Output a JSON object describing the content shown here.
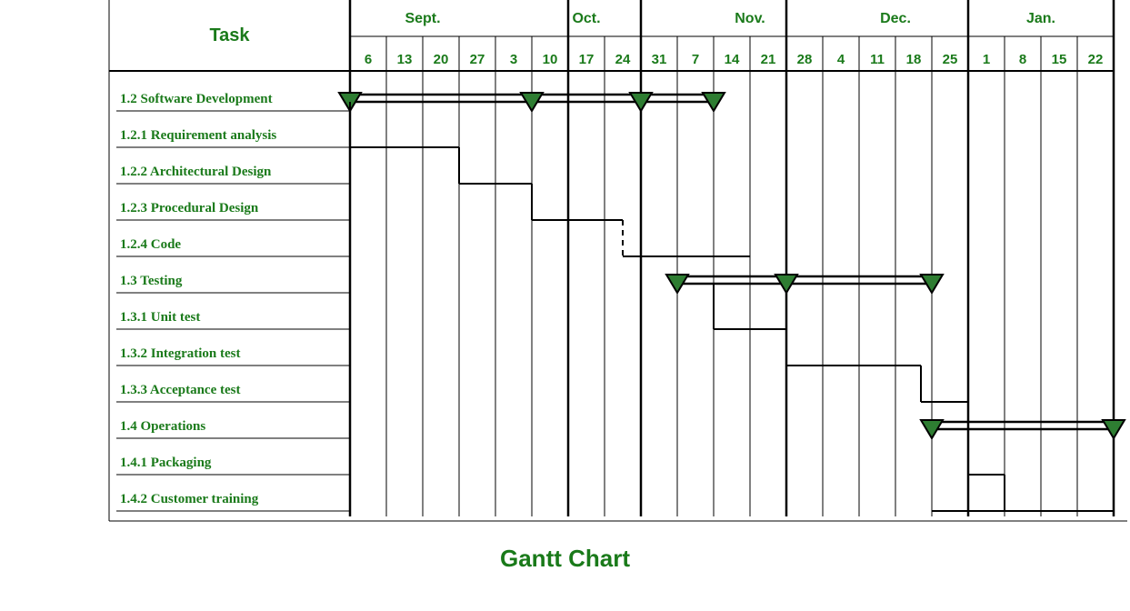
{
  "chart_data": {
    "type": "gantt",
    "title": "Gantt Chart",
    "task_header": "Task",
    "months": [
      "Sept.",
      "Oct.",
      "Nov.",
      "Dec.",
      "Jan."
    ],
    "days": [
      6,
      13,
      20,
      27,
      3,
      10,
      17,
      24,
      31,
      7,
      14,
      21,
      28,
      4,
      11,
      18,
      25,
      1,
      8,
      15,
      22
    ],
    "tasks": [
      {
        "id": "1.2",
        "name": "Software Development",
        "type": "summary",
        "start": 0,
        "end": 10,
        "milestones": [
          0,
          5,
          8,
          10
        ]
      },
      {
        "id": "1.2.1",
        "name": "Requirement analysis",
        "type": "bar",
        "start": 0,
        "end": 3
      },
      {
        "id": "1.2.2",
        "name": "Architectural Design",
        "type": "bar",
        "start": 3,
        "end": 5
      },
      {
        "id": "1.2.3",
        "name": "Procedural Design",
        "type": "bar",
        "start": 5,
        "end": 7.5
      },
      {
        "id": "1.2.4",
        "name": "Code",
        "type": "bar",
        "start": 8,
        "end": 11,
        "depends_from": 7.5
      },
      {
        "id": "1.3",
        "name": "Testing",
        "type": "summary",
        "start": 9,
        "end": 16,
        "milestones": [
          9,
          12,
          16
        ]
      },
      {
        "id": "1.3.1",
        "name": "Unit test",
        "type": "bar",
        "start": 10,
        "end": 12
      },
      {
        "id": "1.3.2",
        "name": "Integration test",
        "type": "bar",
        "start": 12,
        "end": 15.7
      },
      {
        "id": "1.3.3",
        "name": "Acceptance test",
        "type": "bar",
        "start": 15.7,
        "end": 17
      },
      {
        "id": "1.4",
        "name": "Operations",
        "type": "summary",
        "start": 16,
        "end": 21,
        "milestones": [
          16,
          21
        ]
      },
      {
        "id": "1.4.1",
        "name": "Packaging",
        "type": "bar",
        "start": 17,
        "end": 18
      },
      {
        "id": "1.4.2",
        "name": "Customer training",
        "type": "bar",
        "start": 16,
        "end": 21
      }
    ]
  }
}
